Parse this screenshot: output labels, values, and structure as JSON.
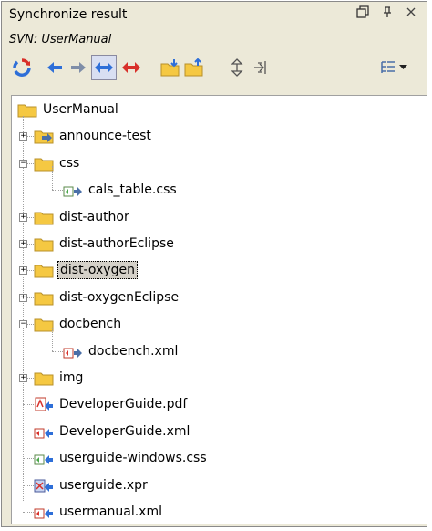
{
  "window": {
    "title": "Synchronize result",
    "subtitle": "SVN: UserManual"
  },
  "toolbar": {
    "active_button": "show-both-directions"
  },
  "tree": {
    "root": "UserManual",
    "items": [
      {
        "label": "announce-test",
        "icon": "folder-outgoing-icon",
        "expander": "+"
      },
      {
        "label": "css",
        "icon": "folder-icon",
        "expander": "-"
      },
      {
        "label": "cals_table.css",
        "icon": "css-file-outgoing-icon"
      },
      {
        "label": "dist-author",
        "icon": "folder-icon",
        "expander": "+"
      },
      {
        "label": "dist-authorEclipse",
        "icon": "folder-icon",
        "expander": "+"
      },
      {
        "label": "dist-oxygen",
        "icon": "folder-icon",
        "expander": "+",
        "selected": true
      },
      {
        "label": "dist-oxygenEclipse",
        "icon": "folder-icon",
        "expander": "+"
      },
      {
        "label": "docbench",
        "icon": "folder-icon",
        "expander": "-"
      },
      {
        "label": "docbench.xml",
        "icon": "xml-file-outgoing-icon"
      },
      {
        "label": "img",
        "icon": "folder-icon",
        "expander": "+"
      },
      {
        "label": "DeveloperGuide.pdf",
        "icon": "pdf-file-incoming-icon"
      },
      {
        "label": "DeveloperGuide.xml",
        "icon": "xml-file-incoming-icon"
      },
      {
        "label": "userguide-windows.css",
        "icon": "css-file-incoming-icon"
      },
      {
        "label": "userguide.xpr",
        "icon": "xpr-file-incoming-icon"
      },
      {
        "label": "usermanual.xml",
        "icon": "xml-file-incoming-icon"
      }
    ]
  },
  "colors": {
    "panel_bg": "#ece9d8",
    "folder": "#f5c842",
    "blue_arrow": "#2e6fd8",
    "red_arrow": "#d8302a"
  }
}
